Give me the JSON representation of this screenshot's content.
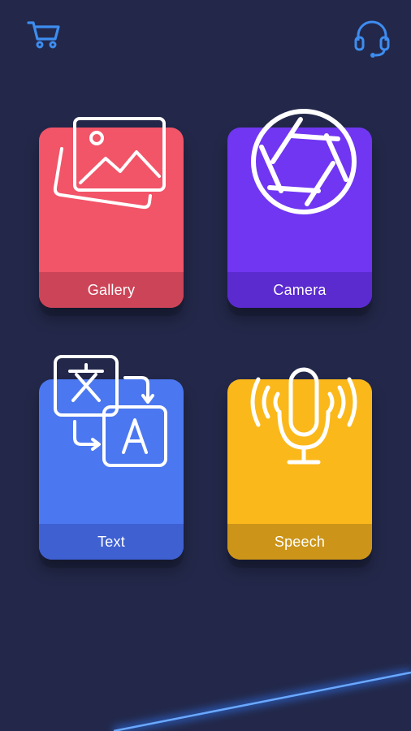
{
  "header": {
    "cart_icon": "cart-icon",
    "support_icon": "headset-icon"
  },
  "cards": {
    "gallery": {
      "label": "Gallery",
      "icon": "image-gallery-icon",
      "color": "#f25468"
    },
    "camera": {
      "label": "Camera",
      "icon": "camera-shutter-icon",
      "color": "#7036f2"
    },
    "text": {
      "label": "Text",
      "icon": "translate-icon",
      "color": "#4b78f0"
    },
    "speech": {
      "label": "Speech",
      "icon": "microphone-icon",
      "color": "#fbb81b"
    }
  },
  "colors": {
    "background": "#23284a",
    "accent_icon": "#3d8df0",
    "glow": "#2f7cff"
  }
}
